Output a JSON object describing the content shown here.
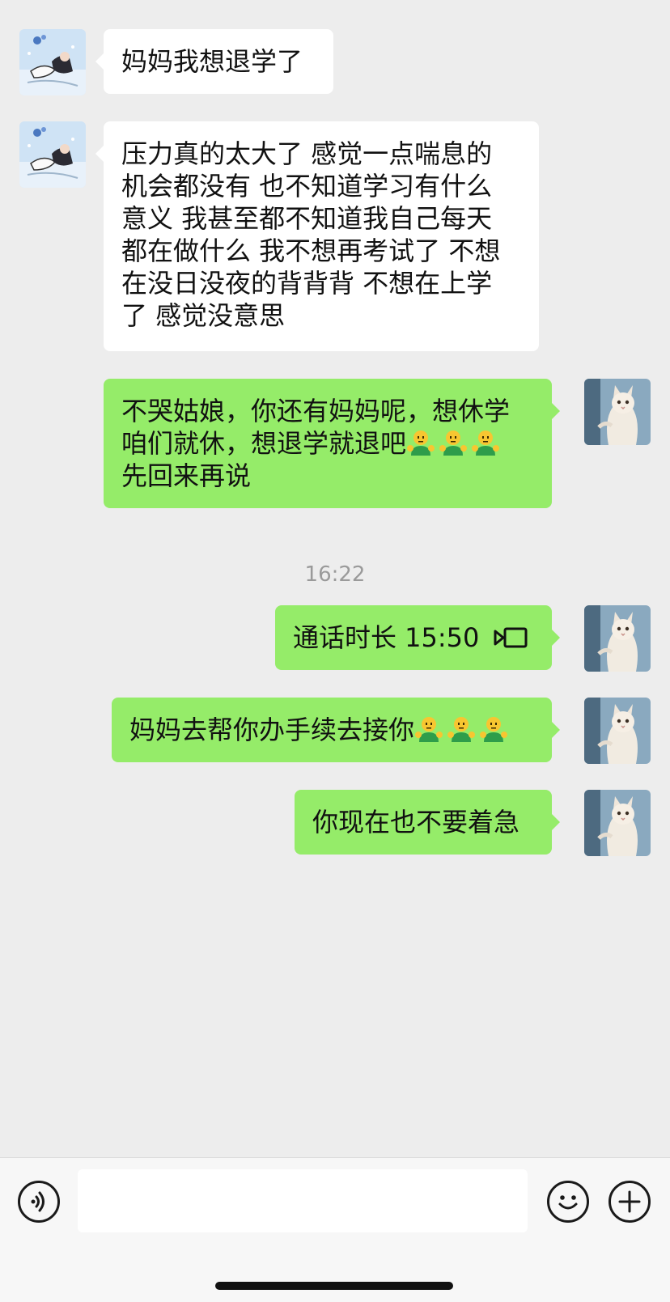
{
  "conversation": {
    "messages": [
      {
        "side": "left",
        "text": "妈妈我想退学了"
      },
      {
        "side": "left",
        "text": "压力真的太大了 感觉一点喘息的\n机会都没有 也不知道学习有什么\n意义 我甚至都不知道我自己每天\n都在做什么 我不想再考试了 不想\n在没日没夜的背背背 不想在上学\n了 感觉没意思"
      },
      {
        "side": "right",
        "line1": "不哭姑娘，你还有妈妈呢，想休学",
        "line2": "咱们就休，想退学就退吧",
        "line3": "先回来再说",
        "emoji_count": 3,
        "emoji": "shrugging-green-icon"
      },
      {
        "side": "right",
        "text": "通话时长 15:50",
        "icon": "video-call-icon"
      },
      {
        "side": "right",
        "text": "妈妈去帮你办手续去接你",
        "emoji_count": 3,
        "emoji": "shrugging-green-icon"
      },
      {
        "side": "right",
        "text": "你现在也不要着急"
      }
    ],
    "timestamp": "16:22"
  },
  "input_bar": {
    "voice_icon": "voice-icon",
    "emoji_icon": "emoji-icon",
    "plus_icon": "plus-icon",
    "input_value": ""
  },
  "colors": {
    "background": "#ededed",
    "bubble_self": "#95ec69",
    "bubble_other": "#ffffff",
    "timestamp": "#9a9a9a"
  }
}
